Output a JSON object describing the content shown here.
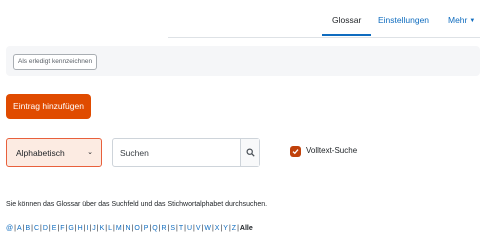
{
  "nav": {
    "items": [
      {
        "label": "Glossar",
        "active": true
      },
      {
        "label": "Einstellungen",
        "active": false
      },
      {
        "label": "Mehr",
        "active": false
      }
    ]
  },
  "completion": {
    "button_label": "Als erledigt kennzeichnen"
  },
  "actions": {
    "add_entry_label": "Eintrag hinzufügen"
  },
  "browse": {
    "mode_selected": "Alphabetisch",
    "search_placeholder": "Suchen",
    "fulltext_label": "Volltext-Suche",
    "fulltext_checked": true
  },
  "help_text": "Sie können das Glossar über das Suchfeld und das Stichwortalphabet durchsuchen.",
  "alphabet": {
    "letters": [
      "@",
      "A",
      "B",
      "C",
      "D",
      "E",
      "F",
      "G",
      "H",
      "I",
      "J",
      "K",
      "L",
      "M",
      "N",
      "O",
      "P",
      "Q",
      "R",
      "S",
      "T",
      "U",
      "V",
      "W",
      "X",
      "Y",
      "Z"
    ],
    "all_label": "Alle"
  },
  "colors": {
    "accent": "#0f6cbf",
    "primary_button": "#e04b00",
    "select_background": "#fcebe2",
    "checkbox": "#c0410a"
  },
  "icons": {
    "search_button": "search-icon",
    "mode_select": "chevron-down-icon",
    "more_menu": "chevron-down-icon",
    "fulltext_checkbox": "checkmark-icon"
  }
}
